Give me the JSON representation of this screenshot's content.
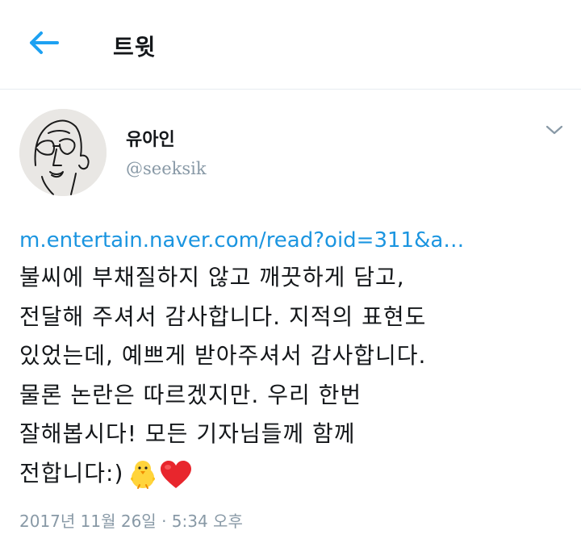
{
  "header": {
    "back_icon": "arrow-left-icon",
    "title": "트윗",
    "accent": "#1da1f2"
  },
  "user": {
    "display_name": "유아인",
    "handle": "@seeksik",
    "avatar_icon": "line-drawing-face-avatar"
  },
  "tweet": {
    "link": "m.entertain.naver.com/read?oid=311&a…",
    "lines": [
      "불씨에 부채질하지 않고 깨끗하게 담고,",
      "전달해 주셔서 감사합니다. 지적의 표현도",
      "있었는데, 예쁘게 받아주셔서 감사합니다.",
      "물론 논란은 따르겠지만. 우리 한번",
      "잘해봅시다! 모든 기자님들께 함께",
      "전합니다:)"
    ],
    "emojis": [
      "chick-emoji",
      "red-heart-emoji"
    ],
    "timestamp": "2017년 11월 26일 · 5:34 오후"
  },
  "colors": {
    "link": "#1b95e0",
    "muted": "#8899a6",
    "divider": "#e6ecf0"
  }
}
